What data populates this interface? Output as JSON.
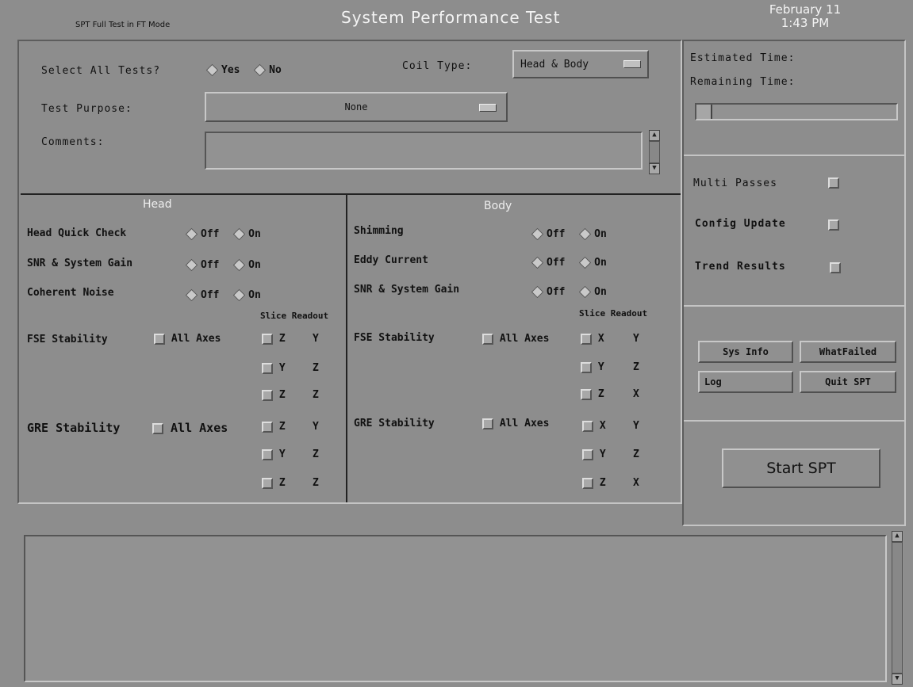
{
  "header": {
    "mode": "SPT Full Test in FT Mode",
    "title": "System Performance Test",
    "date": "February 11",
    "time": "1:43 PM"
  },
  "top": {
    "select_all_label": "Select All Tests?",
    "yes": "Yes",
    "no": "No",
    "coil_type_label": "Coil Type:",
    "coil_type_value": "Head & Body",
    "test_purpose_label": "Test Purpose:",
    "test_purpose_value": "None",
    "comments_label": "Comments:",
    "comments_value": ""
  },
  "head": {
    "title": "Head",
    "tests": [
      {
        "label": "Head Quick Check",
        "off": "Off",
        "on": "On"
      },
      {
        "label": "SNR & System Gain",
        "off": "Off",
        "on": "On"
      },
      {
        "label": "Coherent Noise",
        "off": "Off",
        "on": "On"
      }
    ],
    "col_header": "Slice Readout",
    "fse_label": "FSE Stability",
    "gre_label": "GRE Stability",
    "all_axes": "All Axes",
    "fse_axes": [
      [
        "Z",
        "Y"
      ],
      [
        "Y",
        "Z"
      ],
      [
        "Z",
        "Z"
      ]
    ],
    "gre_axes": [
      [
        "Z",
        "Y"
      ],
      [
        "Y",
        "Z"
      ],
      [
        "Z",
        "Z"
      ]
    ]
  },
  "body": {
    "title": "Body",
    "tests": [
      {
        "label": "Shimming",
        "off": "Off",
        "on": "On"
      },
      {
        "label": "Eddy Current",
        "off": "Off",
        "on": "On"
      },
      {
        "label": "SNR & System Gain",
        "off": "Off",
        "on": "On"
      }
    ],
    "col_header": "Slice Readout",
    "fse_label": "FSE Stability",
    "gre_label": "GRE Stability",
    "all_axes": "All Axes",
    "fse_axes": [
      [
        "X",
        "Y"
      ],
      [
        "Y",
        "Z"
      ],
      [
        "Z",
        "X"
      ]
    ],
    "gre_axes": [
      [
        "X",
        "Y"
      ],
      [
        "Y",
        "Z"
      ],
      [
        "Z",
        "X"
      ]
    ]
  },
  "right": {
    "estimated_time": "Estimated Time:",
    "remaining_time": "Remaining Time:",
    "progress": 0.08,
    "multi_passes": "Multi Passes",
    "config_update": "Config Update",
    "trend_results": "Trend Results",
    "sys_info": "Sys Info",
    "what_failed": "WhatFailed",
    "log": "Log",
    "quit_spt": "Quit SPT",
    "start_spt": "Start SPT"
  },
  "log_area": {
    "text": ""
  }
}
